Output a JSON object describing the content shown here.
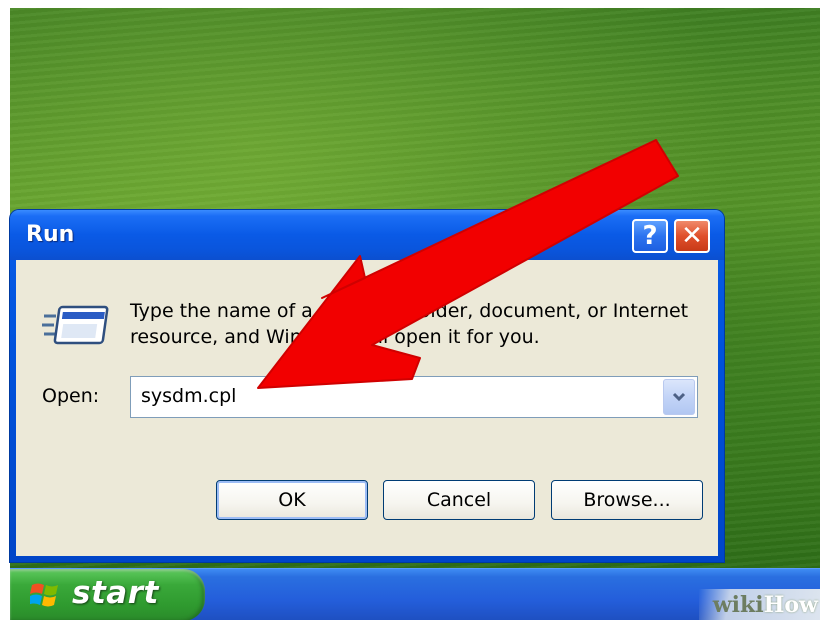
{
  "desktop": {
    "wallpaper": "green-meadow",
    "accent_color": "#4c8f25"
  },
  "taskbar": {
    "start_label": "start",
    "start_icon": "windows-flag-icon",
    "watermark": {
      "part1": "wiki",
      "part2": "How"
    }
  },
  "run_dialog": {
    "title": "Run",
    "help_button_label": "?",
    "close_button_label": "✕",
    "icon": "run-program-icon",
    "description": "Type the name of a program, folder, document, or Internet resource, and Windows will open it for you.",
    "open_label": "Open:",
    "open_value": "sysdm.cpl",
    "ok_label": "OK",
    "cancel_label": "Cancel",
    "browse_label": "Browse...",
    "title_bar_color": "#0a5ae6",
    "client_color": "#ece9d8"
  },
  "overlay": {
    "arrow": "red-pointer-arrow-icon",
    "arrow_color": "#f20000"
  }
}
